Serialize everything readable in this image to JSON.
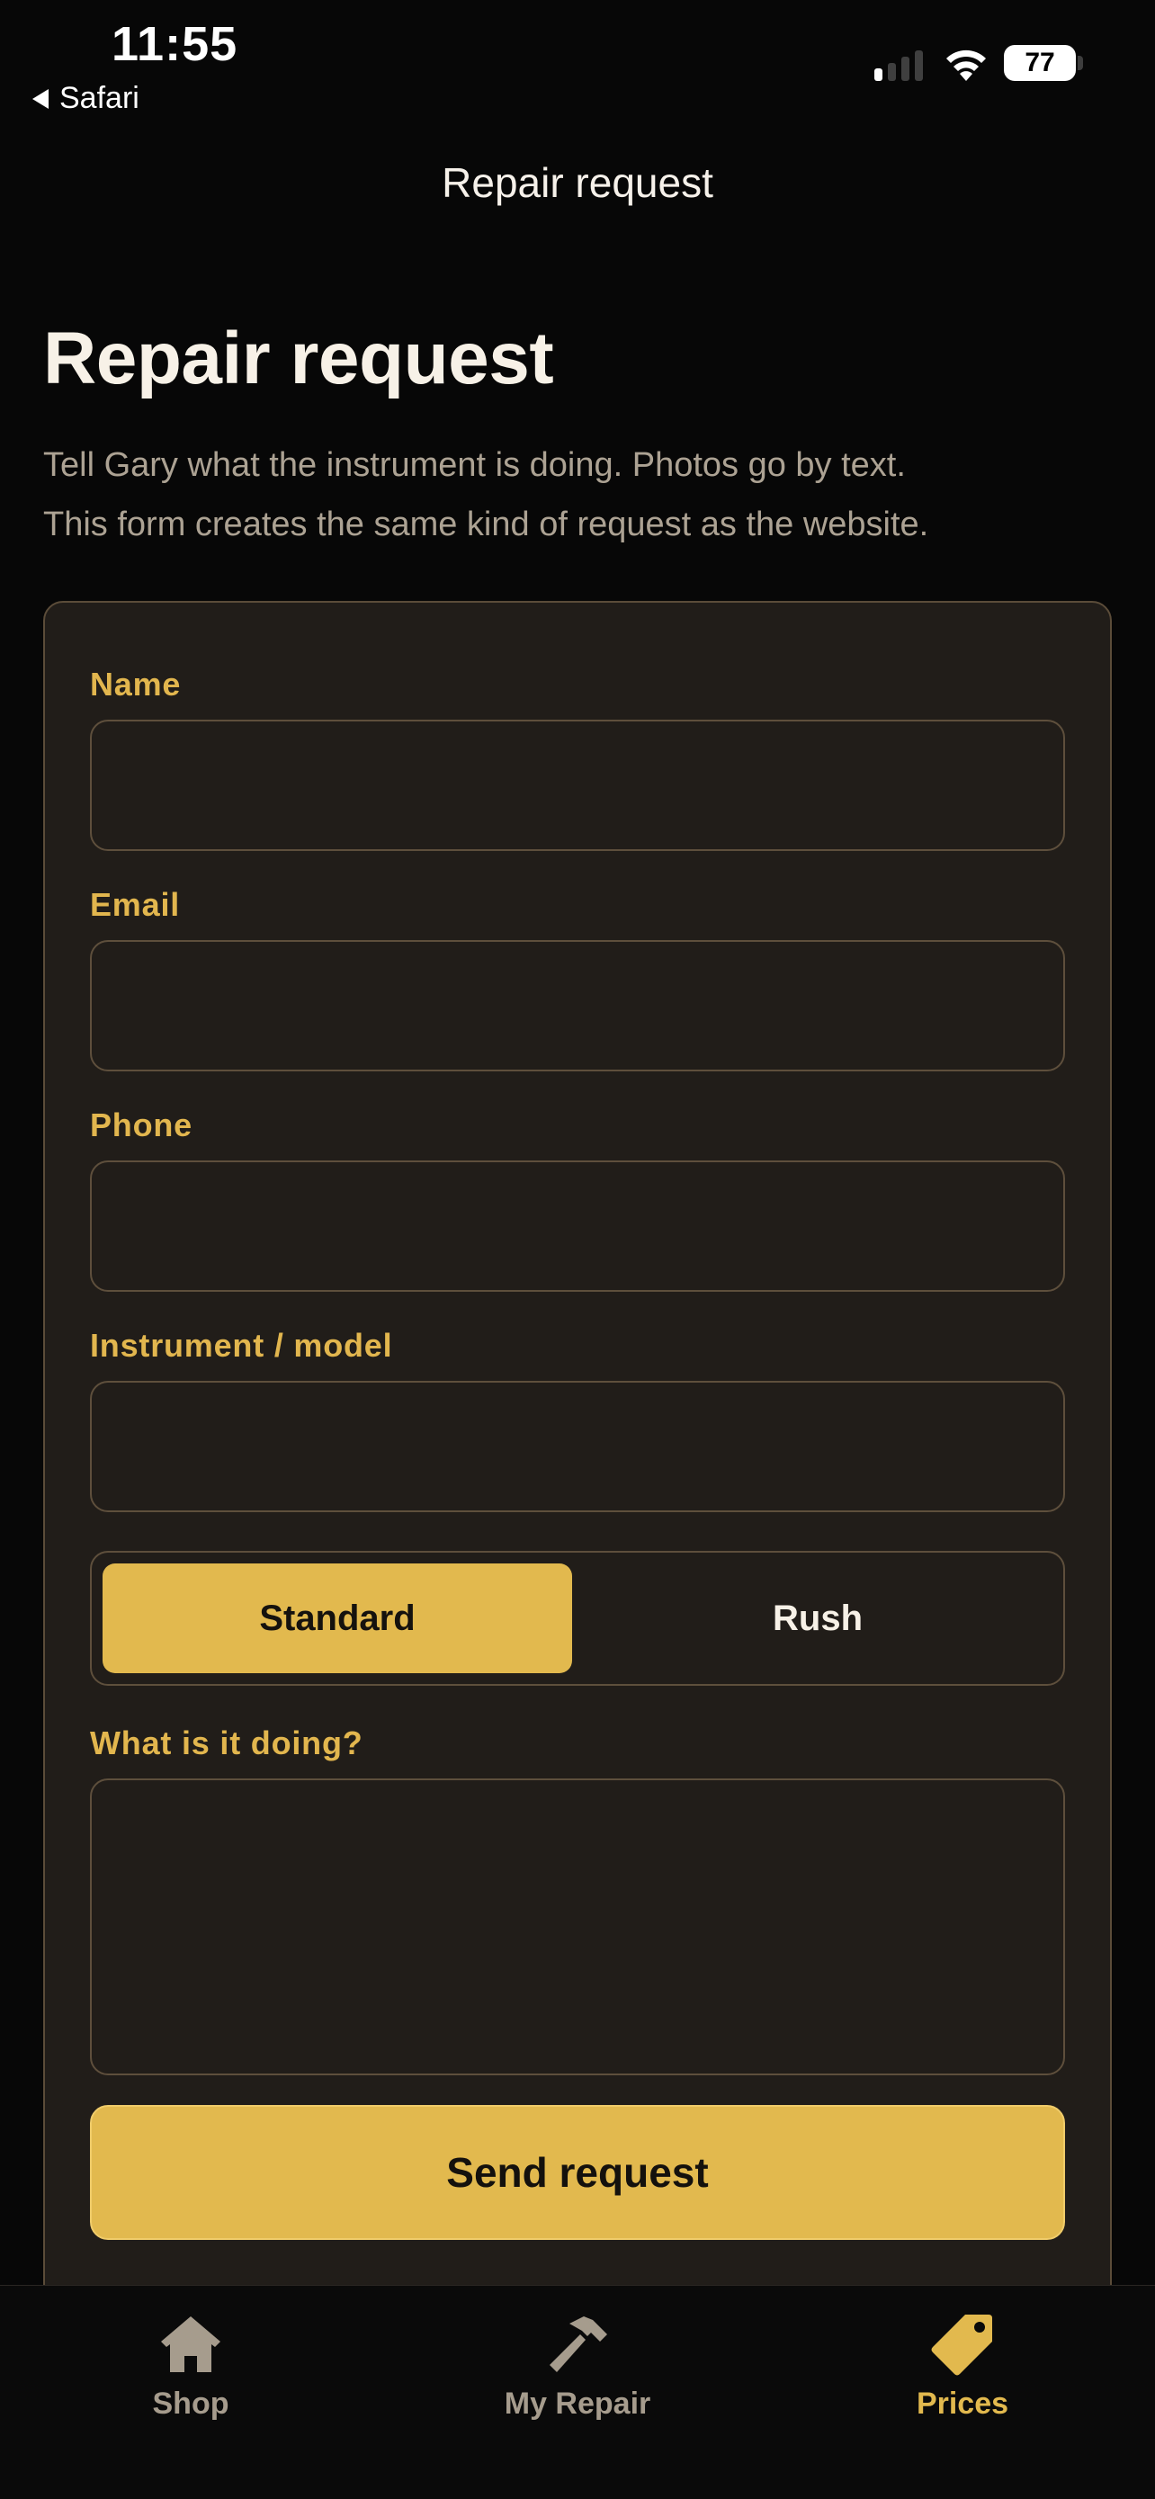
{
  "status_bar": {
    "time": "11:55",
    "back_app": "Safari",
    "battery": "77"
  },
  "nav": {
    "title": "Repair request"
  },
  "page": {
    "title": "Repair request",
    "intro_line1": "Tell Gary what the instrument is doing. Photos go by text.",
    "intro_line2": "This form creates the same kind of request as the website."
  },
  "form": {
    "name_label": "Name",
    "name_value": "",
    "email_label": "Email",
    "email_value": "",
    "phone_label": "Phone",
    "phone_value": "",
    "instrument_label": "Instrument / model",
    "instrument_value": "",
    "priority": {
      "options": [
        "Standard",
        "Rush"
      ],
      "selected": "Standard"
    },
    "issue_label": "What is it doing?",
    "issue_value": "",
    "submit_label": "Send request"
  },
  "tabs": [
    {
      "label": "Shop",
      "icon": "house-icon",
      "active": false
    },
    {
      "label": "My Repair",
      "icon": "hammer-icon",
      "active": false
    },
    {
      "label": "Prices",
      "icon": "price-tag-icon",
      "active": true
    }
  ],
  "colors": {
    "accent": "#E2B94E",
    "background": "#070707",
    "card": "#211D19",
    "muted_text": "#ACA293",
    "inactive_tab": "#A69C8D"
  }
}
